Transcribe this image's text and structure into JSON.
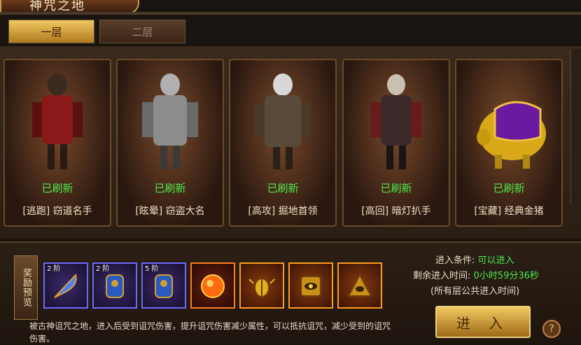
{
  "window": {
    "title": "神咒之地"
  },
  "tabs": [
    {
      "label": "一层",
      "active": true
    },
    {
      "label": "二层",
      "active": false
    }
  ],
  "cards": [
    {
      "status": "已刷新",
      "name": "[逃跑] 窃道名手"
    },
    {
      "status": "已刷新",
      "name": "[眩晕] 窃盗大名"
    },
    {
      "status": "已刷新",
      "name": "[高攻] 掘地首领"
    },
    {
      "status": "已刷新",
      "name": "[高回] 暗灯扒手"
    },
    {
      "status": "已刷新",
      "name": "[宝藏] 经典金猪"
    }
  ],
  "reward": {
    "label": "奖励预览",
    "items": [
      {
        "tier": "2\n阶",
        "icon": "feather-icon",
        "border": "#6a6aff"
      },
      {
        "tier": "2\n阶",
        "icon": "armor-icon",
        "border": "#6a6aff"
      },
      {
        "tier": "5\n阶",
        "icon": "armor-icon",
        "border": "#6a6aff"
      },
      {
        "tier": "",
        "icon": "fire-orb-icon",
        "border": "#ff7a20"
      },
      {
        "tier": "",
        "icon": "beetle-icon",
        "border": "#ff9a20"
      },
      {
        "tier": "",
        "icon": "eye-emblem-icon",
        "border": "#ff9a20"
      },
      {
        "tier": "",
        "icon": "triangle-eye-icon",
        "border": "#ff9a20"
      }
    ]
  },
  "description": "被古神诅咒之地，进入后受到诅咒伤害，提升诅咒伤害减少属性，可以抵抗诅咒，减少受到的诅咒伤害。",
  "conditions": {
    "entry_label": "进入条件:",
    "entry_value": "可以进入",
    "time_label": "剩余进入时间:",
    "time_value": "0小时59分36秒",
    "note": "(所有层公共进入时间)"
  },
  "buttons": {
    "enter": "进 入",
    "help": "?"
  }
}
